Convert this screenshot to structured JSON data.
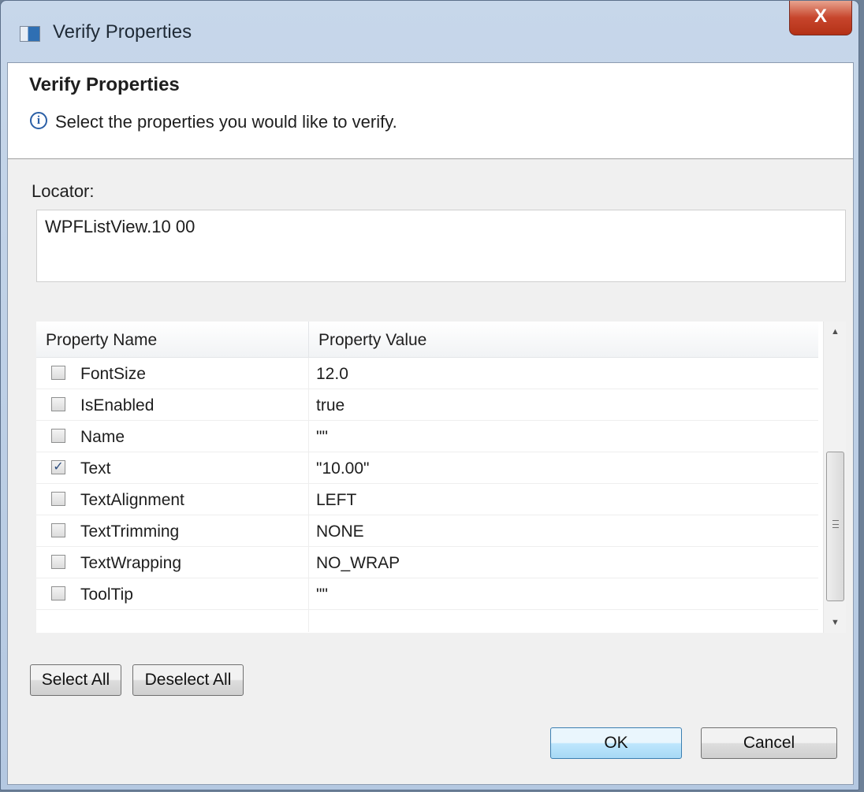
{
  "window": {
    "title": "Verify Properties",
    "close_glyph": "X"
  },
  "header": {
    "title": "Verify Properties",
    "info_glyph": "i",
    "message": "Select the properties you would like to verify."
  },
  "locator": {
    "label": "Locator:",
    "value": "WPFListView.10 00"
  },
  "table": {
    "columns": [
      "Property Name",
      "Property Value"
    ],
    "rows": [
      {
        "name": "FontSize",
        "value": "12.0",
        "checked": false
      },
      {
        "name": "IsEnabled",
        "value": "true",
        "checked": false
      },
      {
        "name": "Name",
        "value": "\"\"",
        "checked": false
      },
      {
        "name": "Text",
        "value": "\"10.00\"",
        "checked": true
      },
      {
        "name": "TextAlignment",
        "value": "LEFT",
        "checked": false
      },
      {
        "name": "TextTrimming",
        "value": "NONE",
        "checked": false
      },
      {
        "name": "TextWrapping",
        "value": "NO_WRAP",
        "checked": false
      },
      {
        "name": "ToolTip",
        "value": "\"\"",
        "checked": false
      }
    ]
  },
  "buttons": {
    "select_all": "Select All",
    "deselect_all": "Deselect All",
    "ok": "OK",
    "cancel": "Cancel"
  },
  "icons": {
    "window": "app-window-icon",
    "close": "close-icon",
    "info": "info-icon",
    "checkbox_checked": "checkmark-icon",
    "scroll_up": "arrow-up-icon",
    "scroll_down": "arrow-down-icon"
  },
  "colors": {
    "accent": "#2b5fa6",
    "close": "#c7452c",
    "ok_button": "#bee6fd"
  }
}
